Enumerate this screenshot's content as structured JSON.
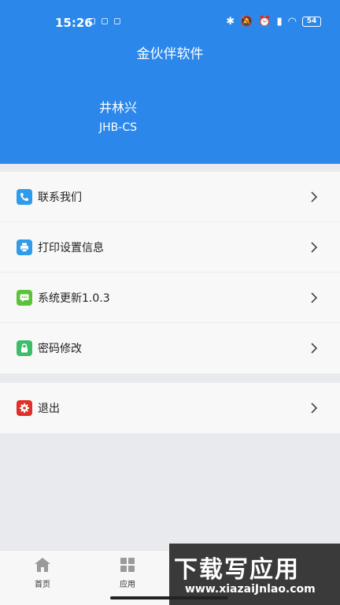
{
  "status_bar": {
    "time": "15:26",
    "battery": "54"
  },
  "header": {
    "title": "金伙伴软件",
    "user_name": "井林兴",
    "user_code": "JHB-CS"
  },
  "menu": [
    {
      "label": "联系我们",
      "icon": "phone-icon",
      "color": "#2f9bea"
    },
    {
      "label": "打印设置信息",
      "icon": "printer-icon",
      "color": "#2f9bea"
    },
    {
      "label": "系统更新1.0.3",
      "icon": "message-icon",
      "color": "#5cc23a"
    },
    {
      "label": "密码修改",
      "icon": "lock-icon",
      "color": "#3cbd6a"
    }
  ],
  "menu2": [
    {
      "label": "退出",
      "icon": "gear-icon",
      "color": "#e0302a"
    }
  ],
  "tabs": [
    {
      "label": "首页",
      "icon": "home-icon"
    },
    {
      "label": "应用",
      "icon": "grid-icon"
    }
  ],
  "watermark": {
    "top": "下载写应用",
    "bottom": "www.xiazaiJnlao.com"
  }
}
